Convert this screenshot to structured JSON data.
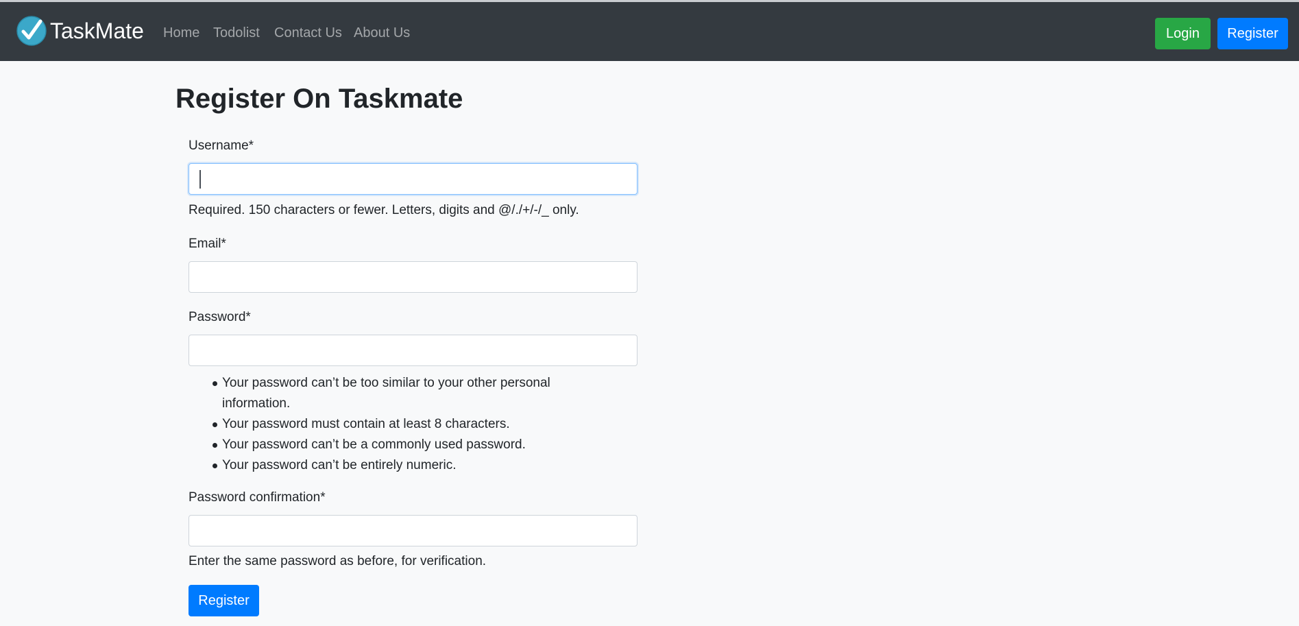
{
  "navbar": {
    "brand": "TaskMate",
    "links": [
      "Home",
      "Todolist",
      "Contact Us",
      "About Us"
    ],
    "login_label": "Login",
    "register_label": "Register"
  },
  "form": {
    "title": "Register On Taskmate",
    "username": {
      "label": "Username*",
      "value": "",
      "help": "Required. 150 characters or fewer. Letters, digits and @/./+/-/_ only."
    },
    "email": {
      "label": "Email*",
      "value": ""
    },
    "password": {
      "label": "Password*",
      "value": "",
      "rules": [
        "Your password can’t be too similar to your other personal information.",
        "Your password must contain at least 8 characters.",
        "Your password can’t be a commonly used password.",
        "Your password can’t be entirely numeric."
      ]
    },
    "password_confirmation": {
      "label": "Password confirmation*",
      "value": "",
      "help": "Enter the same password as before, for verification."
    },
    "submit_label": "Register"
  },
  "colors": {
    "navbar_bg": "#343a40",
    "login_green": "#28a745",
    "primary_blue": "#007bff",
    "logo_teal": "#3ba8c9"
  }
}
